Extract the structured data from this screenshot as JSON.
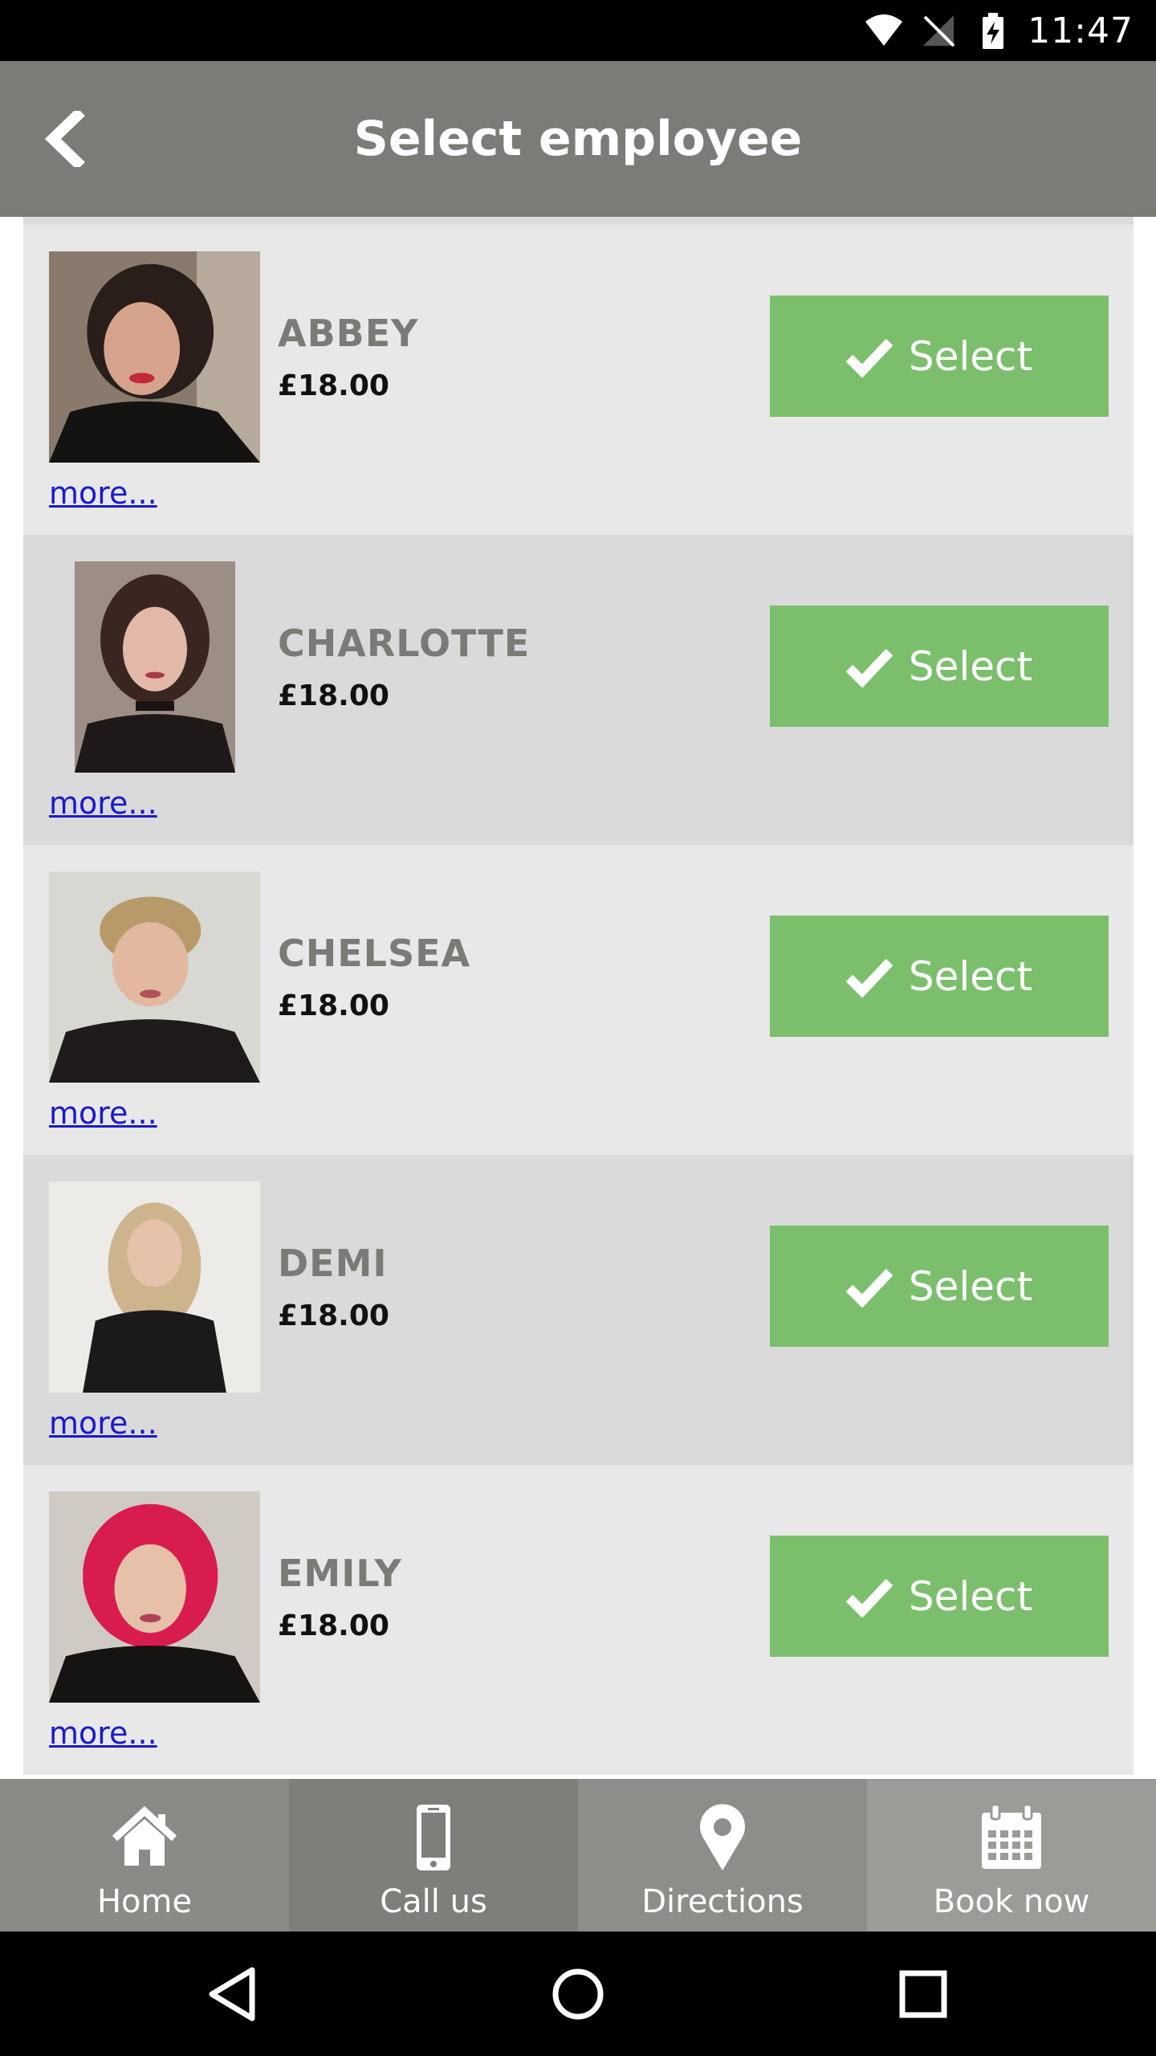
{
  "status_bar": {
    "time": "11:47",
    "icons": [
      "wifi-icon",
      "no-signal-icon",
      "battery-charging-icon"
    ]
  },
  "header": {
    "title": "Select employee",
    "back_icon": "chevron-left-icon"
  },
  "employees": [
    {
      "name": "ABBEY",
      "price": "£18.00",
      "select_label": "Select",
      "more_label": "more..."
    },
    {
      "name": "CHARLOTTE",
      "price": "£18.00",
      "select_label": "Select",
      "more_label": "more..."
    },
    {
      "name": "CHELSEA",
      "price": "£18.00",
      "select_label": "Select",
      "more_label": "more..."
    },
    {
      "name": "DEMI",
      "price": "£18.00",
      "select_label": "Select",
      "more_label": "more..."
    },
    {
      "name": "EMILY",
      "price": "£18.00",
      "select_label": "Select",
      "more_label": "more..."
    }
  ],
  "bottom_nav": [
    {
      "label": "Home",
      "icon": "home-icon",
      "color": "#8a8a86"
    },
    {
      "label": "Call us",
      "icon": "phone-icon",
      "color": "#7e7e7a"
    },
    {
      "label": "Directions",
      "icon": "map-pin-icon",
      "color": "#8d8d89"
    },
    {
      "label": "Book now",
      "icon": "calendar-icon",
      "color": "#9b9b97"
    }
  ],
  "colors": {
    "app_bar": "#7b7b77",
    "select_button": "#7bbf6c",
    "row_light": "#e8e8e8",
    "row_dark": "#dadada",
    "link": "#1a1acc"
  }
}
